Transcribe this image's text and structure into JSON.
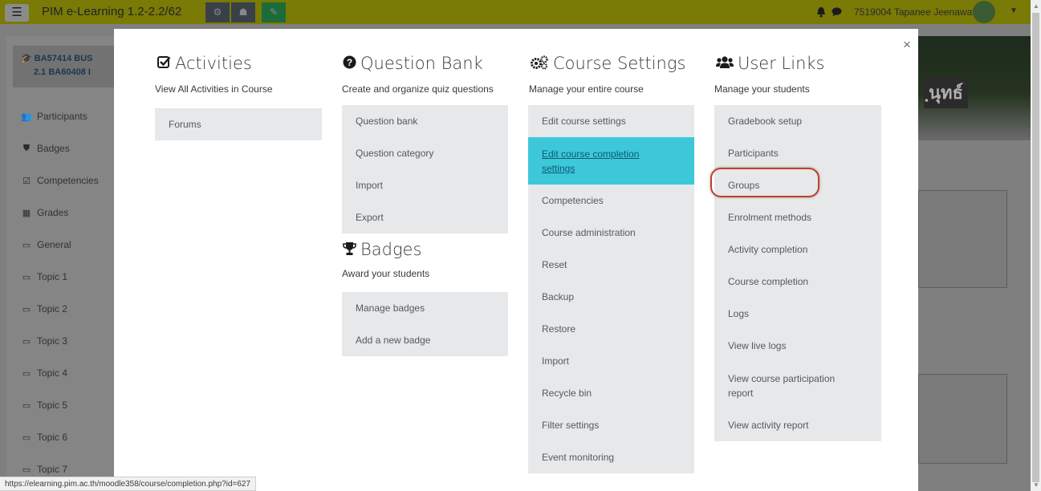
{
  "navbar": {
    "site_title": "PIM e-Learning 1.2-2.2/62",
    "user_name": "7519004 Tapanee Jeenawat",
    "icons": [
      "menu-icon",
      "gear-icon",
      "sitemap-icon",
      "edit-icon",
      "bell-icon",
      "chat-icon",
      "avatar",
      "caret-down-icon"
    ]
  },
  "drawer": {
    "course": [
      "BA57414 BUS",
      "2.1 BA60408 I"
    ],
    "items": [
      {
        "label": "Participants",
        "icon": "users-icon"
      },
      {
        "label": "Badges",
        "icon": "shield-icon"
      },
      {
        "label": "Competencies",
        "icon": "check-square-icon"
      },
      {
        "label": "Grades",
        "icon": "table-icon"
      },
      {
        "label": "General",
        "icon": "folder-icon"
      },
      {
        "label": "Topic 1",
        "icon": "folder-icon"
      },
      {
        "label": "Topic 2",
        "icon": "folder-icon"
      },
      {
        "label": "Topic 3",
        "icon": "folder-icon"
      },
      {
        "label": "Topic 4",
        "icon": "folder-icon"
      },
      {
        "label": "Topic 5",
        "icon": "folder-icon"
      },
      {
        "label": "Topic 6",
        "icon": "folder-icon"
      },
      {
        "label": "Topic 7",
        "icon": "folder-icon"
      }
    ]
  },
  "header": {
    "title_fragment": "ฺนุทธ์"
  },
  "modal": {
    "close_label": "×",
    "activities": {
      "title": "Activities",
      "subtitle": "View All Activities in Course",
      "icon": "check-square-icon",
      "items": [
        "Forums"
      ]
    },
    "question_bank": {
      "title": "Question Bank",
      "subtitle": "Create and organize quiz questions",
      "icon": "question-circle-icon",
      "items": [
        "Question bank",
        "Question category",
        "Import",
        "Export"
      ]
    },
    "badges": {
      "title": "Badges",
      "subtitle": "Award your students",
      "icon": "trophy-icon",
      "items": [
        "Manage badges",
        "Add a new badge"
      ]
    },
    "course_settings": {
      "title": "Course Settings",
      "subtitle": "Manage your entire course",
      "icon": "cogs-icon",
      "items": [
        "Edit course settings",
        "Edit course completion settings",
        "Competencies",
        "Course administration",
        "Reset",
        "Backup",
        "Restore",
        "Import",
        "Recycle bin",
        "Filter settings",
        "Event monitoring"
      ],
      "active_item": "Edit course completion settings"
    },
    "user_links": {
      "title": "User Links",
      "subtitle": "Manage your students",
      "icon": "users-icon",
      "items": [
        "Gradebook setup",
        "Participants",
        "Groups",
        "Enrolment methods",
        "Activity completion",
        "Course completion",
        "Logs",
        "View live logs",
        "View course participation report",
        "View activity report"
      ],
      "highlighted_item": "Groups"
    }
  },
  "status_url": "https://elearning.pim.ac.th/moodle358/course/completion.php?id=627",
  "colors": {
    "navbar": "#7a7a06",
    "menu_bg": "#e6e8e9",
    "active_item": "#3dc8d9",
    "highlight_ring": "#c0412b"
  }
}
